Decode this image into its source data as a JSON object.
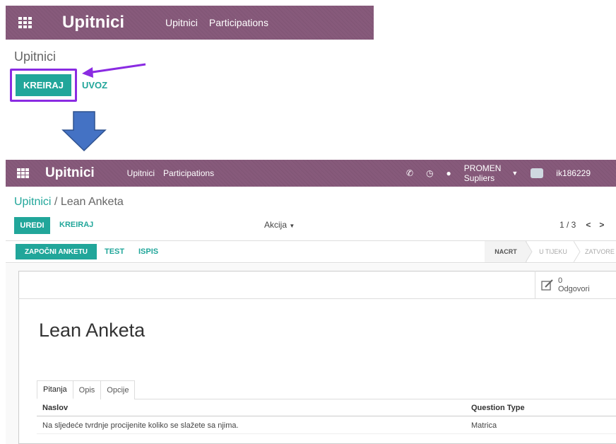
{
  "top": {
    "navbar": {
      "brand": "Upitnici",
      "menu": [
        "Upitnici",
        "Participations"
      ]
    },
    "title": "Upitnici",
    "buttons": {
      "create": "KREIRAJ",
      "import": "UVOZ"
    }
  },
  "bottom": {
    "navbar": {
      "brand": "Upitnici",
      "menu": [
        "Upitnici",
        "Participations"
      ],
      "company": "PROMEN Supliers",
      "user": "ik186229"
    },
    "breadcrumb": {
      "parent": "Upitnici",
      "separator": "/",
      "current": "Lean Anketa"
    },
    "control": {
      "edit": "UREDI",
      "create": "KREIRAJ",
      "action": "Akcija",
      "pager": "1 / 3"
    },
    "statusbar": {
      "buttons": [
        "ZAPOČNI ANKETU",
        "TEST",
        "ISPIS"
      ],
      "stages": [
        "NACRT",
        "U TIJEKU",
        "ZATVORE"
      ]
    },
    "stat_button": {
      "count": "0",
      "label": "Odgovori"
    },
    "record_title": "Lean Anketa",
    "tabs": [
      "Pitanja",
      "Opis",
      "Opcije"
    ],
    "table": {
      "headers": [
        "Naslov",
        "Question Type"
      ],
      "rows": [
        {
          "title": "Na sljedeće tvrdnje procijenite koliko se slažete sa njima.",
          "type": "Matrica"
        }
      ]
    }
  },
  "colors": {
    "navbar": "#875a7b",
    "primary": "#21a69a",
    "highlight": "#8a2be2",
    "arrow": "#4472c4"
  }
}
